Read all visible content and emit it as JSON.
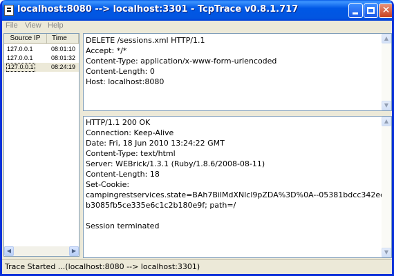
{
  "window": {
    "title": "localhost:8080 --> localhost:3301 - TcpTrace v0.8.1.717"
  },
  "menu": [
    "File",
    "View",
    "Help"
  ],
  "table": {
    "headers": [
      "Source IP",
      "Time"
    ],
    "rows": [
      {
        "ip": "127.0.0.1",
        "time": "08:01:10"
      },
      {
        "ip": "127.0.0.1",
        "time": "08:01:32"
      },
      {
        "ip": "127.0.0.1",
        "time": "08:24:19"
      }
    ],
    "selected_index": 2
  },
  "request": {
    "lines": [
      "DELETE /sessions.xml HTTP/1.1",
      "Accept: */*",
      "Content-Type: application/x-www-form-urlencoded",
      "Content-Length: 0",
      "Host: localhost:8080"
    ]
  },
  "response": {
    "lines": [
      "HTTP/1.1 200 OK",
      "Connection: Keep-Alive",
      "Date: Fri, 18 Jun 2010 13:24:22 GMT",
      "Content-Type: text/html",
      "Server: WEBrick/1.3.1 (Ruby/1.8.6/2008-08-11)",
      "Content-Length: 18",
      "Set-Cookie:",
      "campingrestservices.state=BAh7BilMdXNlcl9pZDA%3D%0A--05381bdcc342ec",
      "b3085fb5ce335e6c1c2b180e9f; path=/",
      "",
      "Session terminated"
    ]
  },
  "status_bar": {
    "text": "Trace Started ...(localhost:8080 --> localhost:3301)"
  }
}
